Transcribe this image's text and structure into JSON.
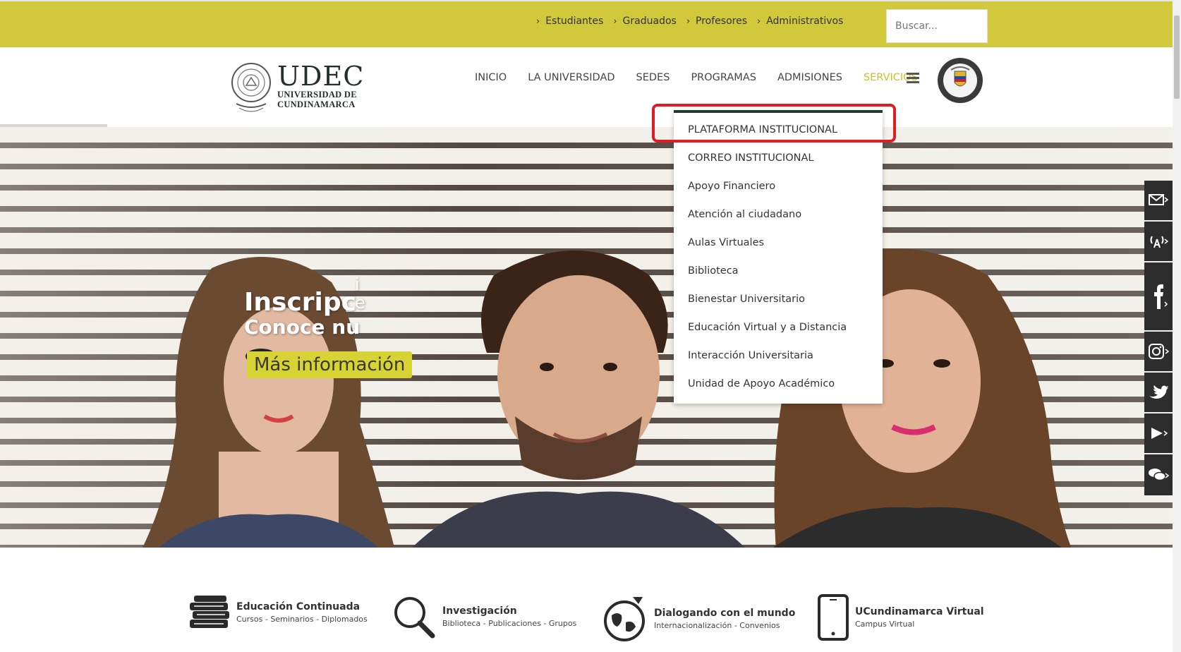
{
  "topbar": {
    "links": [
      "Estudiantes",
      "Graduados",
      "Profesores",
      "Administrativos"
    ],
    "search_placeholder": "Buscar..."
  },
  "logo": {
    "main": "UDEC",
    "line1": "UNIVERSIDAD DE",
    "line2": "CUNDINAMARCA"
  },
  "nav": {
    "items": [
      "INICIO",
      "LA UNIVERSIDAD",
      "SEDES",
      "PROGRAMAS",
      "ADMISIONES",
      "SERVICIOS"
    ],
    "active": "SERVICIOS"
  },
  "hero": {
    "line1": "Inscripc",
    "line1_tail_top": "i",
    "line1_tail_bottom": "e",
    "line2": "Conoce nu",
    "button": "Más información"
  },
  "dropdown": {
    "items": [
      "PLATAFORMA INSTITUCIONAL",
      "CORREO INSTITUCIONAL",
      "Apoyo Financiero",
      "Atención al ciudadano",
      "Aulas Virtuales",
      "Biblioteca",
      "Bienestar Universitario",
      "Educación Virtual y a Distancia",
      "Interacción Universitaria",
      "Unidad de Apoyo Académico"
    ]
  },
  "features": [
    {
      "title": "Educación Continuada",
      "subtitle": "Cursos - Seminarios - Diplomados",
      "icon": "books-icon"
    },
    {
      "title": "Investigación",
      "subtitle": "Biblioteca - Publicaciones - Grupos",
      "icon": "magnifier-icon"
    },
    {
      "title": "Dialogando con el mundo",
      "subtitle": "Internacionalización - Convenios",
      "icon": "globe-plane-icon"
    },
    {
      "title": "UCundinamarca Virtual",
      "subtitle": "Campus Virtual",
      "icon": "smartphone-icon"
    }
  ],
  "colors": {
    "accent": "#d2c83c",
    "dark_green": "#1f3b34",
    "highlight": "#e01b24"
  }
}
